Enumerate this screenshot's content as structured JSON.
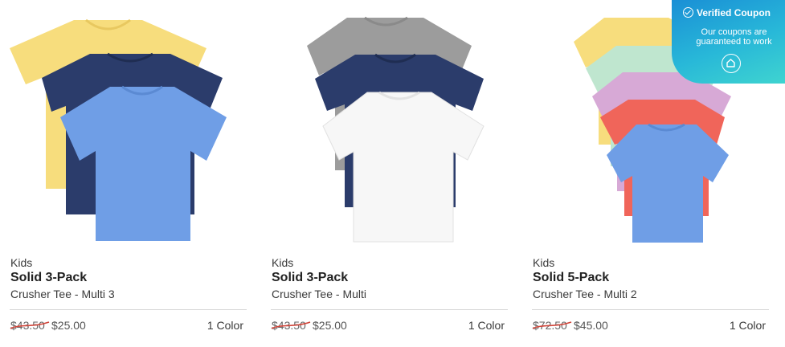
{
  "products": [
    {
      "category": "Kids",
      "title": "Solid 3-Pack",
      "subtitle": "Crusher Tee - Multi 3",
      "old_price": "$43.50",
      "new_price": "$25.00",
      "colors": "1 Color",
      "shirt_colors": [
        "#f7dd7d",
        "#2b3c6b",
        "#6f9ee6"
      ]
    },
    {
      "category": "Kids",
      "title": "Solid 3-Pack",
      "subtitle": "Crusher Tee - Multi",
      "old_price": "$43.50",
      "new_price": "$25.00",
      "colors": "1 Color",
      "shirt_colors": [
        "#9c9c9c",
        "#2b3c6b",
        "#f7f7f7"
      ]
    },
    {
      "category": "Kids",
      "title": "Solid 5-Pack",
      "subtitle": "Crusher Tee - Multi 2",
      "old_price": "$72.50",
      "new_price": "$45.00",
      "colors": "1 Color",
      "shirt_colors": [
        "#f7dd7d",
        "#bfe6cf",
        "#d7a9d6",
        "#f0655a",
        "#6f9ee6"
      ]
    }
  ],
  "coupon": {
    "title": "Verified Coupon",
    "message": "Our coupons are guaranteed to work"
  },
  "colors": {
    "strike": "#d0463b",
    "coupon_gradient_start": "#1a8fd6",
    "coupon_gradient_end": "#3fd4d0"
  }
}
